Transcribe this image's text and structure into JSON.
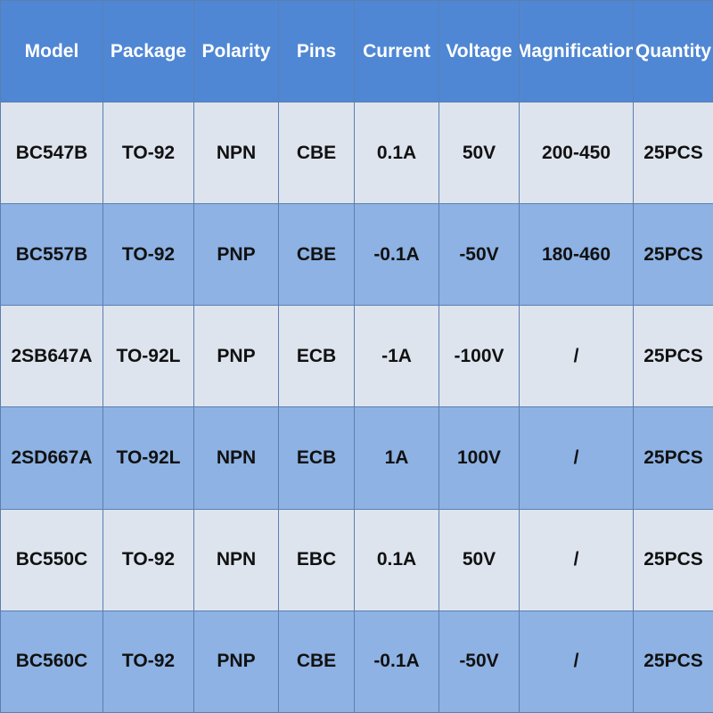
{
  "header": {
    "model": "Model",
    "package": "Package",
    "polarity": "Polarity",
    "pins": "Pins",
    "current": "Current",
    "voltage": "Voltage",
    "magnification": "Magnification",
    "quantity": "Quantity"
  },
  "rows": [
    {
      "model": "BC547B",
      "package": "TO-92",
      "polarity": "NPN",
      "pins": "CBE",
      "current": "0.1A",
      "voltage": "50V",
      "magnification": "200-450",
      "quantity": "25PCS"
    },
    {
      "model": "BC557B",
      "package": "TO-92",
      "polarity": "PNP",
      "pins": "CBE",
      "current": "-0.1A",
      "voltage": "-50V",
      "magnification": "180-460",
      "quantity": "25PCS"
    },
    {
      "model": "2SB647A",
      "package": "TO-92L",
      "polarity": "PNP",
      "pins": "ECB",
      "current": "-1A",
      "voltage": "-100V",
      "magnification": "/",
      "quantity": "25PCS"
    },
    {
      "model": "2SD667A",
      "package": "TO-92L",
      "polarity": "NPN",
      "pins": "ECB",
      "current": "1A",
      "voltage": "100V",
      "magnification": "/",
      "quantity": "25PCS"
    },
    {
      "model": "BC550C",
      "package": "TO-92",
      "polarity": "NPN",
      "pins": "EBC",
      "current": "0.1A",
      "voltage": "50V",
      "magnification": "/",
      "quantity": "25PCS"
    },
    {
      "model": "BC560C",
      "package": "TO-92",
      "polarity": "PNP",
      "pins": "CBE",
      "current": "-0.1A",
      "voltage": "-50V",
      "magnification": "/",
      "quantity": "25PCS"
    }
  ],
  "colors": {
    "header_bg": "#4f87d4",
    "row_light_bg": "#dde4ee",
    "row_blue_bg": "#8db2e3"
  }
}
